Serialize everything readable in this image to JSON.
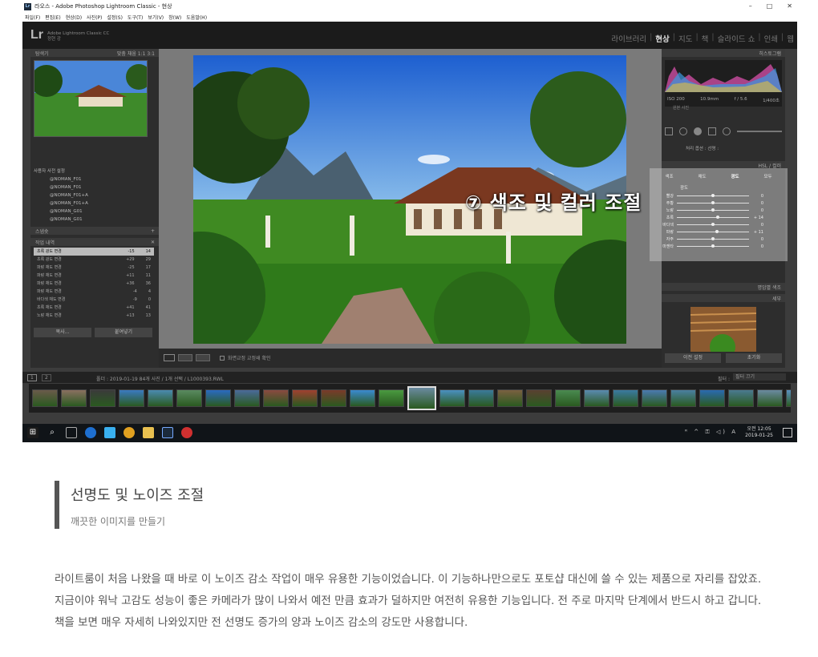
{
  "window": {
    "title": "라오스 - Adobe Photoshop Lightroom Classic - 현상",
    "icon_label": "Lr",
    "controls": [
      "–",
      "□",
      "✕"
    ]
  },
  "menu": [
    "파일(F)",
    "편집(E)",
    "현상(D)",
    "사진(P)",
    "설정(S)",
    "도구(T)",
    "보기(V)",
    "창(W)",
    "도움말(H)"
  ],
  "app": {
    "logo": "Lr",
    "logo_line1": "Adobe Lightroom Classic CC",
    "logo_line2": "정현 강",
    "modules": [
      "라이브러리",
      "현상",
      "지도",
      "책",
      "슬라이드 쇼",
      "인쇄",
      "웹"
    ],
    "active_module": "현상"
  },
  "left_panel": {
    "navigator_label": "탐색기",
    "navigator_opts": "맞춤  채움  1:1  3:1",
    "preset_group": "사용자 사전 설정",
    "presets": [
      "@NOMAN_F01",
      "@NOMAN_F01",
      "@NOMAN_F01+A",
      "@NOMAN_F01+A",
      "@NOMAN_G01",
      "@NOMAN_G01"
    ],
    "snapshots_label": "스냅숏",
    "history_label": "작업 내역",
    "history": [
      {
        "name": "초록 광도 변경",
        "a": "-15",
        "b": "14"
      },
      {
        "name": "초록 광도 변경",
        "a": "+29",
        "b": "29"
      },
      {
        "name": "파랑 채도 변경",
        "a": "-25",
        "b": "17"
      },
      {
        "name": "파랑 채도 변경",
        "a": "+11",
        "b": "11"
      },
      {
        "name": "파랑 채도 변경",
        "a": "+36",
        "b": "36"
      },
      {
        "name": "파랑 채도 변경",
        "a": "-4",
        "b": "4"
      },
      {
        "name": "바다색 채도 변경",
        "a": "-9",
        "b": "0"
      },
      {
        "name": "초록 채도 변경",
        "a": "+41",
        "b": "41"
      },
      {
        "name": "노랑 채도 변경",
        "a": "+13",
        "b": "13"
      }
    ],
    "copy_button": "복사...",
    "paste_button": "붙여넣기"
  },
  "right_panel": {
    "histogram_label": "히스토그램",
    "iso": "ISO 200",
    "focal": "10.9mm",
    "aperture": "f / 5.6",
    "shutter": "1/400초",
    "original": "원본 사진",
    "profile_label": "처리 옵션 :",
    "profile_value": "선명 :",
    "hsl_label": "HSL / 컬러",
    "hsl_tabs": [
      "색조",
      "채도",
      "광도",
      "모두"
    ],
    "hsl_section": "광도",
    "hsl_rows": [
      {
        "label": "빨강",
        "value": "0",
        "pos": 0.5
      },
      {
        "label": "주황",
        "value": "0",
        "pos": 0.5
      },
      {
        "label": "노랑",
        "value": "0",
        "pos": 0.5
      },
      {
        "label": "초록",
        "value": "+ 14",
        "pos": 0.57
      },
      {
        "label": "바다색",
        "value": "0",
        "pos": 0.5
      },
      {
        "label": "파랑",
        "value": "+ 11",
        "pos": 0.56
      },
      {
        "label": "자주",
        "value": "0",
        "pos": 0.5
      },
      {
        "label": "마젠타",
        "value": "0",
        "pos": 0.5
      }
    ],
    "split_toning": "명암별 색조",
    "detail_label": "세부",
    "prev_button": "이전 설정",
    "reset_button": "초기화"
  },
  "toolbar": {
    "softproof": "화면교정 교정쇄 확인"
  },
  "filmstrip": {
    "pages": [
      "1",
      "2"
    ],
    "info": "폴더 : 2019-01-19   84개 사진 / 1개 선택 / L1000393.RWL",
    "filter_label": "필터 :",
    "filter_value": "필터 끄기"
  },
  "overlay_text": "⑦ 색조 및 컬러 조절",
  "taskbar": {
    "time": "오전 12:05",
    "date": "2019-01-25",
    "tray": "ᴿ ^ ⚿ ◁) A"
  },
  "article": {
    "title": "선명도 및 노이즈 조절",
    "subtitle": "깨끗한 이미지를 만들기",
    "body": "라이트룸이 처음 나왔을 때 바로 이 노이즈 감소 작업이 매우 유용한 기능이었습니다. 이 기능하나만으로도 포토샵 대신에 쓸 수 있는 제품으로 자리를 잡았죠. 지금이야 워낙 고감도 성능이 좋은 카메라가 많이 나와서 예전 만큼 효과가 덜하지만 여전히 유용한 기능입니다. 전 주로 마지막 단계에서 반드시 하고 갑니다. 책을 보면 매우 자세히 나와있지만 전 선명도 증가의 양과 노이즈 감소의 강도만 사용합니다."
  }
}
